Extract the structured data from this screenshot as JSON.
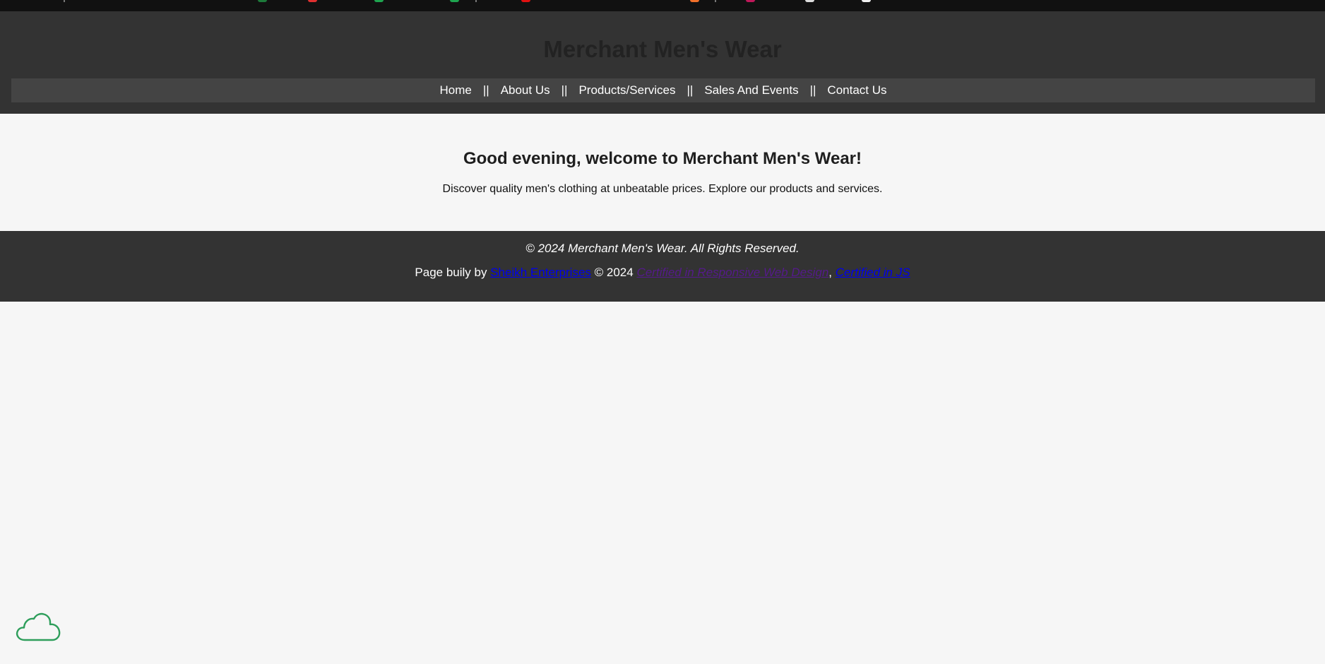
{
  "header": {
    "title": "Merchant Men's Wear"
  },
  "nav": {
    "items": [
      {
        "label": "Home"
      },
      {
        "label": "About Us"
      },
      {
        "label": "Products/Services"
      },
      {
        "label": "Sales And Events"
      },
      {
        "label": "Contact Us"
      }
    ],
    "separator": "||"
  },
  "main": {
    "heading": "Good evening, welcome to Merchant Men's Wear!",
    "intro": "Discover quality men's clothing at unbeatable prices. Explore our products and services."
  },
  "footer": {
    "copyright": "© 2024 Merchant Men's Wear. All Rights Reserved.",
    "built_prefix": "Page buily by",
    "builder_link": "Sheikh Enterprises",
    "year_text": "© 2024",
    "cert1_link": "Certified in Responsive Web Design",
    "comma": ",",
    "cert2_link": "Certified in JS"
  },
  "floating": {
    "icon": "cloud-icon"
  },
  "colors": {
    "page_bg": "#f6f6f6",
    "header_bg": "#333333",
    "nav_bg": "#444444",
    "title_color": "#222222",
    "link_blue": "#0000ee",
    "link_visited": "#551a8b",
    "cloud_green": "#2e9e5b"
  }
}
